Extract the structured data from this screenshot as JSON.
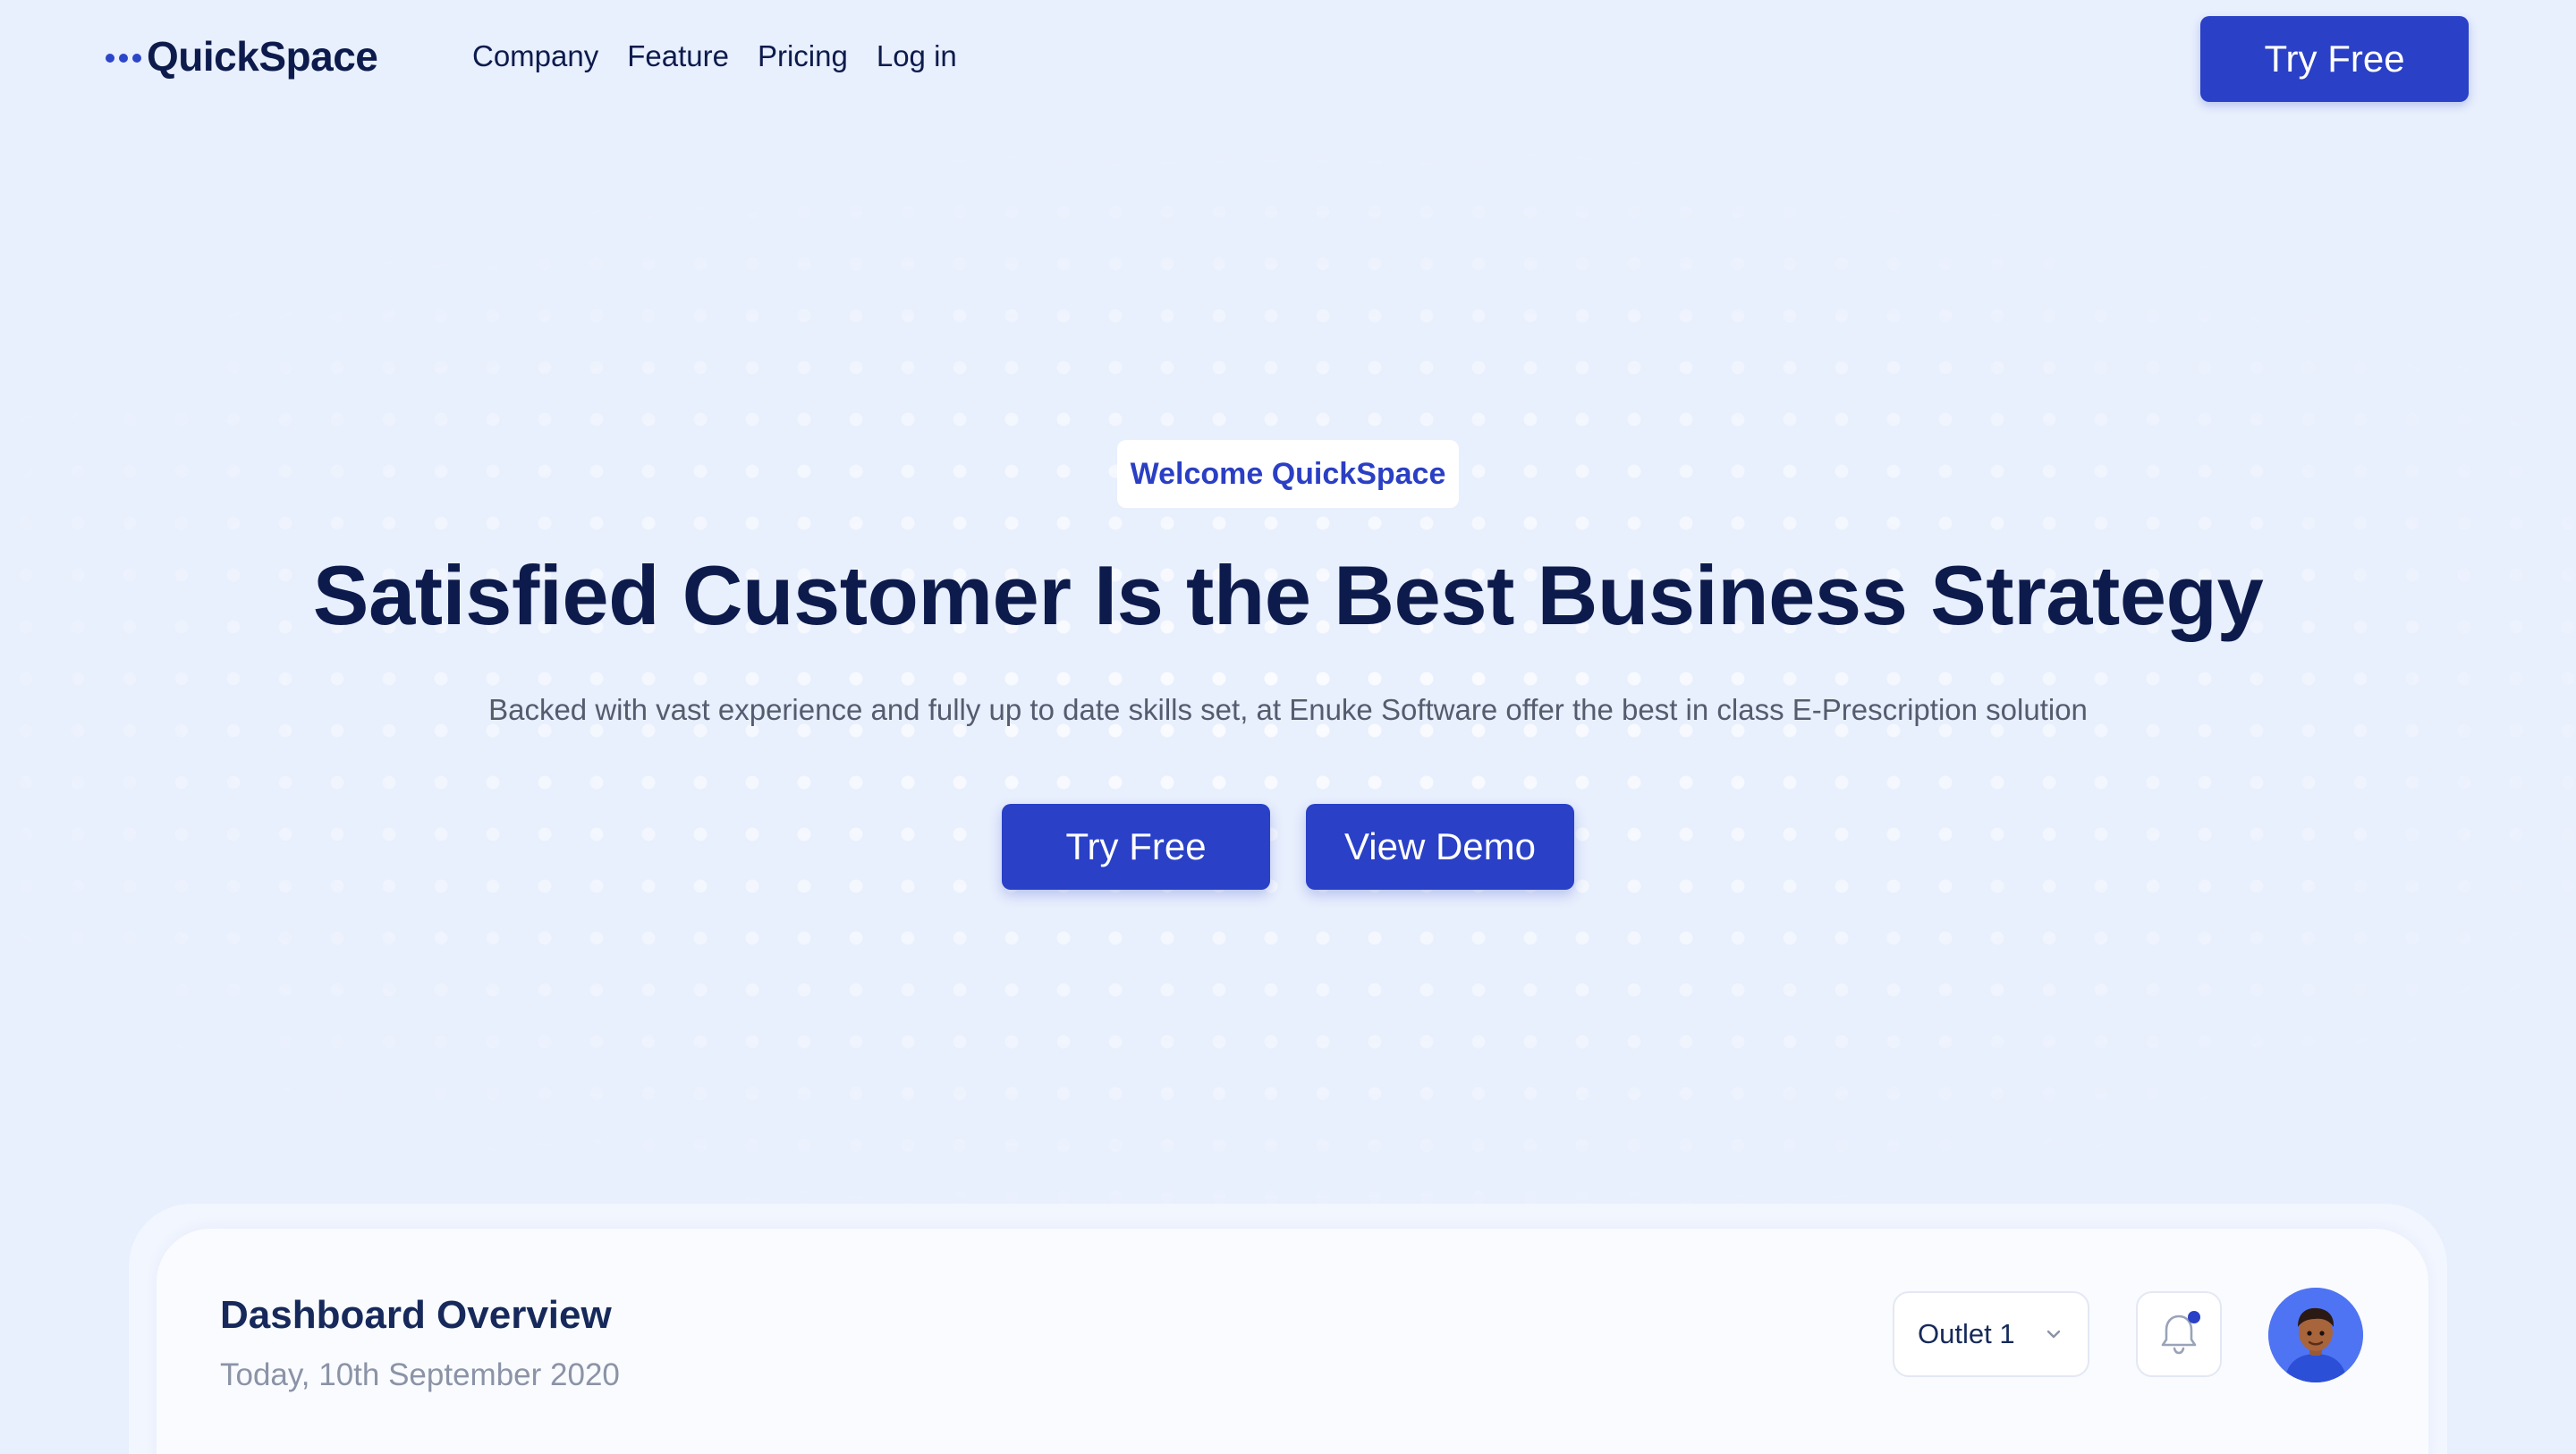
{
  "brand": {
    "name": "QuickSpace",
    "accent": "#2940c7",
    "text_dark": "#0d1b4c"
  },
  "nav": {
    "links": [
      "Company",
      "Feature",
      "Pricing",
      "Log in"
    ],
    "cta": "Try Free"
  },
  "hero": {
    "badge": "Welcome QuickSpace",
    "title": "Satisfied Customer Is the Best Business Strategy",
    "subtitle": "Backed with vast experience and fully up to date skills set, at Enuke Software offer the best in class E-Prescription solution",
    "primary_button": "Try Free",
    "secondary_button": "View Demo"
  },
  "dashboard": {
    "title": "Dashboard Overview",
    "date": "Today, 10th September 2020",
    "outlet_select": "Outlet 1",
    "icons": [
      "chevron-down-icon",
      "bell-icon",
      "avatar"
    ]
  }
}
